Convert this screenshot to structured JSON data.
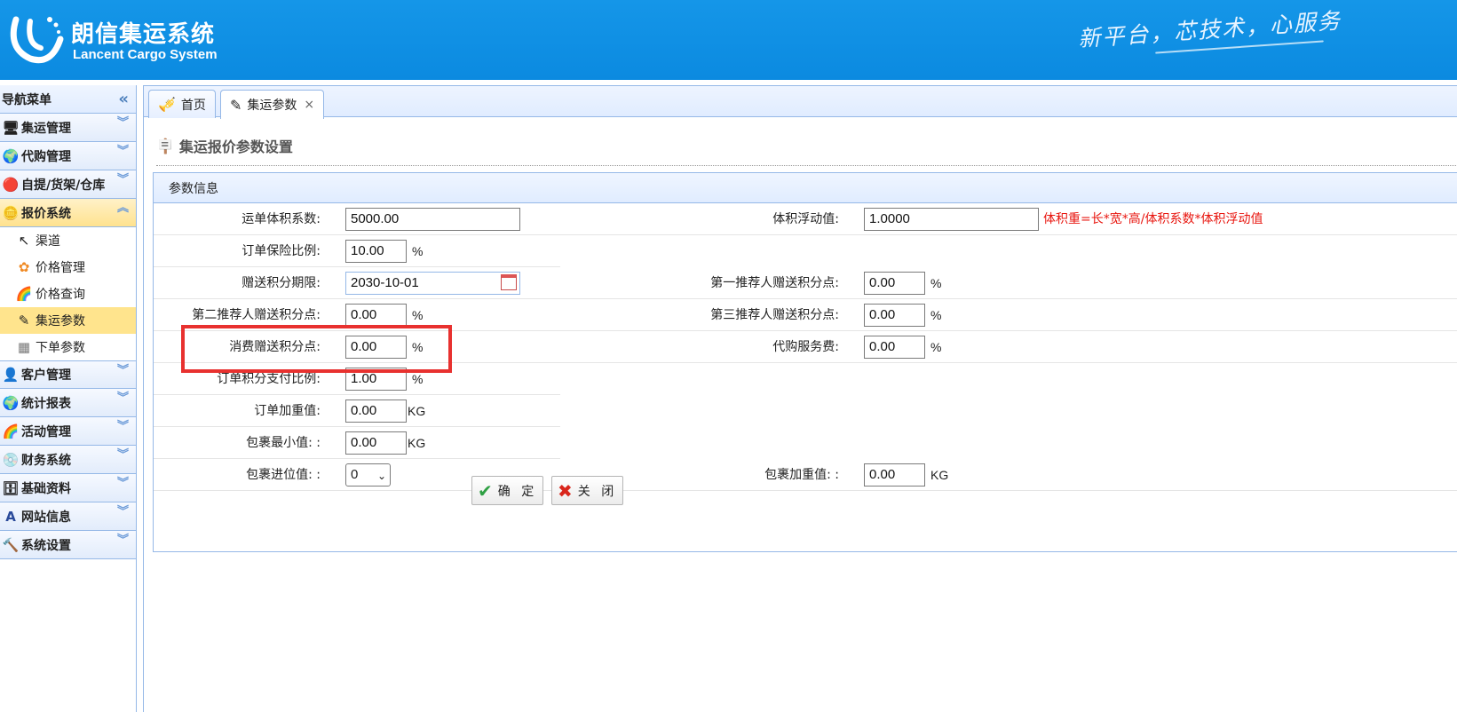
{
  "header": {
    "title_cn": "朗信集运系统",
    "title_en": "Lancent Cargo System",
    "slogan": "新平台，芯技术，心服务"
  },
  "sidebar": {
    "title": "导航菜单",
    "groups": [
      {
        "label": "集运管理",
        "icon": "monitor-icon"
      },
      {
        "label": "代购管理",
        "icon": "globe-icon"
      },
      {
        "label": "自提/货架/仓库",
        "icon": "stop-icon"
      },
      {
        "label": "报价系统",
        "icon": "coins-icon",
        "active": true,
        "items": [
          {
            "label": "渠道",
            "icon": "route-icon"
          },
          {
            "label": "价格管理",
            "icon": "flower-icon"
          },
          {
            "label": "价格查询",
            "icon": "rainbow-icon"
          },
          {
            "label": "集运参数",
            "icon": "pencil-icon",
            "active": true
          },
          {
            "label": "下单参数",
            "icon": "grid-icon"
          }
        ]
      },
      {
        "label": "客户管理",
        "icon": "user-icon"
      },
      {
        "label": "统计报表",
        "icon": "globe-icon"
      },
      {
        "label": "活动管理",
        "icon": "rainbow-icon"
      },
      {
        "label": "财务系统",
        "icon": "disc-icon"
      },
      {
        "label": "基础资料",
        "icon": "database-icon"
      },
      {
        "label": "网站信息",
        "icon": "font-icon"
      },
      {
        "label": "系统设置",
        "icon": "hammer-icon"
      }
    ]
  },
  "tabs": [
    {
      "label": "首页",
      "icon": "home-tab-icon"
    },
    {
      "label": "集运参数",
      "icon": "pencil-icon",
      "close": "×"
    }
  ],
  "page": {
    "title": "集运报价参数设置",
    "panel_title": "参数信息"
  },
  "form": {
    "volume_factor_label": "运单体积系数:",
    "volume_factor_value": "5000.00",
    "volume_float_label": "体积浮动值:",
    "volume_float_value": "1.0000",
    "volume_hint": "体积重=长*宽*高/体积系数*体积浮动值",
    "insurance_label": "订单保险比例:",
    "insurance_value": "10.00",
    "points_expiry_label": "赠送积分期限:",
    "points_expiry_value": "2030-10-01",
    "ref1_label": "第一推荐人赠送积分点:",
    "ref1_value": "0.00",
    "ref2_label": "第二推荐人赠送积分点:",
    "ref2_value": "0.00",
    "ref3_label": "第三推荐人赠送积分点:",
    "ref3_value": "0.00",
    "consume_points_label": "消费赠送积分点:",
    "consume_points_value": "0.00",
    "purchase_fee_label": "代购服务费:",
    "purchase_fee_value": "0.00",
    "points_pay_label": "订单积分支付比例:",
    "points_pay_value": "1.00",
    "order_weight_label": "订单加重值:",
    "order_weight_value": "0.00",
    "parcel_min_label": "包裹最小值: :",
    "parcel_min_value": "0.00",
    "parcel_step_label": "包裹进位值: :",
    "parcel_step_value": "0",
    "parcel_weight_label": "包裹加重值: :",
    "parcel_weight_value": "0.00",
    "percent": "%",
    "kg": "KG"
  },
  "buttons": {
    "confirm": "确 定",
    "close": "关 闭"
  },
  "colors": {
    "header_blue": "#0b8ae0",
    "hint_red": "#e8150e",
    "highlight_red": "#e8312f",
    "active_yellow": "#ffe48d"
  }
}
